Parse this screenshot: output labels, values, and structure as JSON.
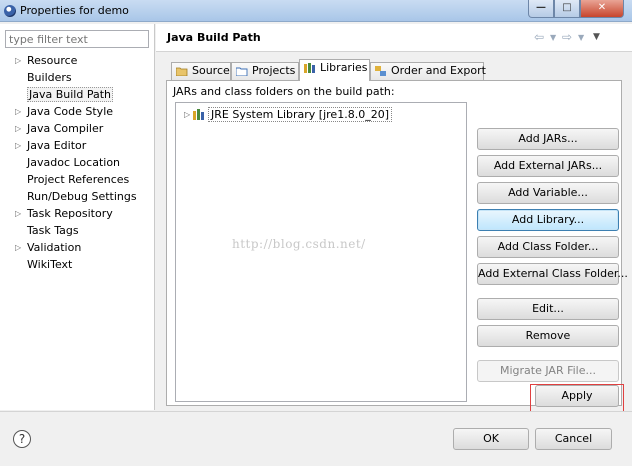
{
  "window": {
    "title": "Properties for demo"
  },
  "filter": {
    "placeholder": "type filter text"
  },
  "tree": [
    {
      "label": "Resource",
      "expandable": true
    },
    {
      "label": "Builders",
      "expandable": false
    },
    {
      "label": "Java Build Path",
      "expandable": false,
      "selected": true
    },
    {
      "label": "Java Code Style",
      "expandable": true
    },
    {
      "label": "Java Compiler",
      "expandable": true
    },
    {
      "label": "Java Editor",
      "expandable": true
    },
    {
      "label": "Javadoc Location",
      "expandable": false
    },
    {
      "label": "Project References",
      "expandable": false
    },
    {
      "label": "Run/Debug Settings",
      "expandable": false
    },
    {
      "label": "Task Repository",
      "expandable": true
    },
    {
      "label": "Task Tags",
      "expandable": false
    },
    {
      "label": "Validation",
      "expandable": true
    },
    {
      "label": "WikiText",
      "expandable": false
    }
  ],
  "page": {
    "title": "Java Build Path"
  },
  "tabs": [
    {
      "label": "Source",
      "icon": "source-folder-icon"
    },
    {
      "label": "Projects",
      "icon": "projects-icon"
    },
    {
      "label": "Libraries",
      "icon": "libraries-icon",
      "active": true
    },
    {
      "label": "Order and Export",
      "icon": "order-export-icon"
    }
  ],
  "libraries": {
    "label": "JARs and class folders on the build path:",
    "items": [
      {
        "label": "JRE System Library [jre1.8.0_20]"
      }
    ]
  },
  "buttons": {
    "add_jars": "Add JARs...",
    "add_external_jars": "Add External JARs...",
    "add_variable": "Add Variable...",
    "add_library": "Add Library...",
    "add_class_folder": "Add Class Folder...",
    "add_external_class_folder": "Add External Class Folder...",
    "edit": "Edit...",
    "remove": "Remove",
    "migrate_jar": "Migrate JAR File...",
    "apply": "Apply",
    "ok": "OK",
    "cancel": "Cancel"
  },
  "watermark": "http://blog.csdn.net/",
  "colors": {
    "highlight": "#e04040",
    "selection_focus": "#3c7fb1"
  }
}
